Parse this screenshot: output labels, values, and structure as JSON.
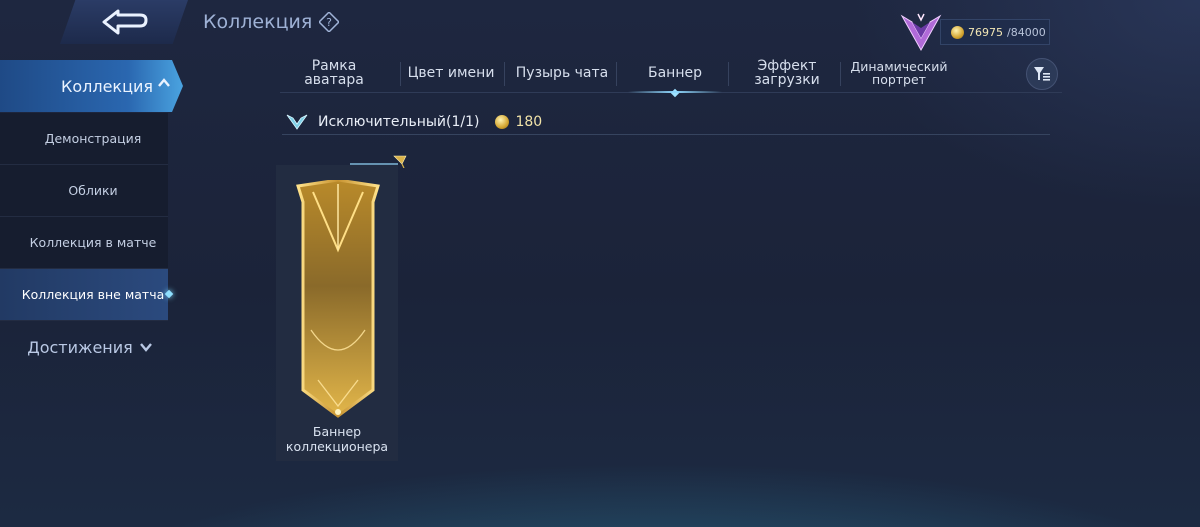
{
  "header": {
    "title": "Коллекция",
    "help_icon": "help-question-icon",
    "back_icon": "back-arrow-icon",
    "currency": {
      "value": "76975",
      "max": "/84000",
      "icon": "coin-icon"
    }
  },
  "sidebar": {
    "main_label": "Коллекция",
    "items": [
      {
        "label": "Демонстрация"
      },
      {
        "label": "Облики"
      },
      {
        "label": "Коллекция в матче"
      },
      {
        "label": "Коллекция вне матча"
      }
    ],
    "achievements_label": "Достижения"
  },
  "tabs": [
    {
      "label": "Рамка аватара"
    },
    {
      "label": "Цвет имени"
    },
    {
      "label": "Пузырь чата"
    },
    {
      "label": "Баннер"
    },
    {
      "label": "Эффект загрузки"
    },
    {
      "label": "Динамический портрет"
    }
  ],
  "active_tab": "Баннер",
  "rarity": {
    "label": "Исключительный(1/1)",
    "price": "180"
  },
  "cards": [
    {
      "label": "Баннер коллекционера"
    }
  ],
  "colors": {
    "accent": "#4aa3e0",
    "gold": "#d3a531",
    "background": "#1e2740"
  }
}
